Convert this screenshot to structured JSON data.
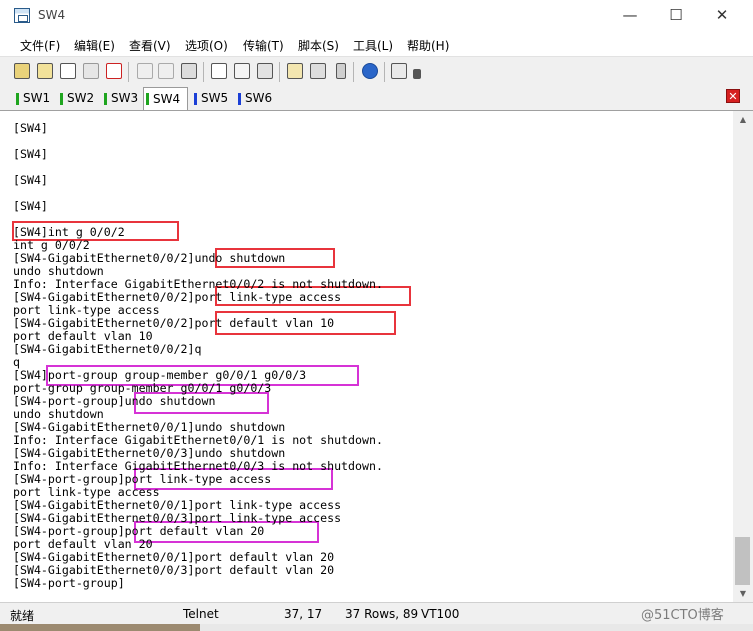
{
  "window": {
    "title": "SW4",
    "controls": {
      "minimize": "—",
      "maximize": "☐",
      "close": "✕"
    }
  },
  "menu": [
    "文件(F)",
    "编辑(E)",
    "查看(V)",
    "选项(O)",
    "传输(T)",
    "脚本(S)",
    "工具(L)",
    "帮助(H)"
  ],
  "toolbar_icons": [
    "connect-icon",
    "quick-connect-icon",
    "connect-tab-icon",
    "reconnect-icon",
    "disconnect-icon",
    "copy-icon",
    "paste-icon",
    "find-icon",
    "print-setup-icon",
    "print-icon",
    "print-screen-icon",
    "session-options-icon",
    "global-options-icon",
    "keymap-icon",
    "help-icon",
    "sftp-icon",
    "toolbar-more-icon"
  ],
  "tabs": [
    {
      "label": "SW1",
      "color": "#1fa51f",
      "active": false
    },
    {
      "label": "SW2",
      "color": "#1fa51f",
      "active": false
    },
    {
      "label": "SW3",
      "color": "#1fa51f",
      "active": false
    },
    {
      "label": "SW4",
      "color": "#1fa51f",
      "active": true
    },
    {
      "label": "SW5",
      "color": "#1b3fd6",
      "active": false
    },
    {
      "label": "SW6",
      "color": "#1b3fd6",
      "active": false
    }
  ],
  "close_tab_label": "✕",
  "terminal": {
    "lines": [
      "[SW4]",
      "",
      "[SW4]",
      "",
      "[SW4]",
      "",
      "[SW4]",
      "",
      "[SW4]int g 0/0/2",
      "int g 0/0/2",
      "[SW4-GigabitEthernet0/0/2]undo shutdown",
      "undo shutdown",
      "Info: Interface GigabitEthernet0/0/2 is not shutdown.",
      "[SW4-GigabitEthernet0/0/2]port link-type access",
      "port link-type access",
      "[SW4-GigabitEthernet0/0/2]port default vlan 10",
      "port default vlan 10",
      "[SW4-GigabitEthernet0/0/2]q",
      "q",
      "[SW4]port-group group-member g0/0/1 g0/0/3",
      "port-group group-member g0/0/1 g0/0/3",
      "[SW4-port-group]undo shutdown",
      "undo shutdown",
      "[SW4-GigabitEthernet0/0/1]undo shutdown",
      "Info: Interface GigabitEthernet0/0/1 is not shutdown.",
      "[SW4-GigabitEthernet0/0/3]undo shutdown",
      "Info: Interface GigabitEthernet0/0/3 is not shutdown.",
      "[SW4-port-group]port link-type access",
      "port link-type access",
      "[SW4-GigabitEthernet0/0/1]port link-type access",
      "[SW4-GigabitEthernet0/0/3]port link-type access",
      "[SW4-port-group]port default vlan 20",
      "port default vlan 20",
      "[SW4-GigabitEthernet0/0/1]port default vlan 20",
      "[SW4-GigabitEthernet0/0/3]port default vlan 20",
      "[SW4-port-group]"
    ]
  },
  "status": {
    "state": "就绪",
    "protocol": "Telnet",
    "cursor": "37,  17",
    "size": "37 Rows, 89",
    "terminal_type": "VT100"
  },
  "watermark": "@51CTO博客",
  "highlight_colors": {
    "red": "#e8343c",
    "magenta": "#d633d6"
  }
}
